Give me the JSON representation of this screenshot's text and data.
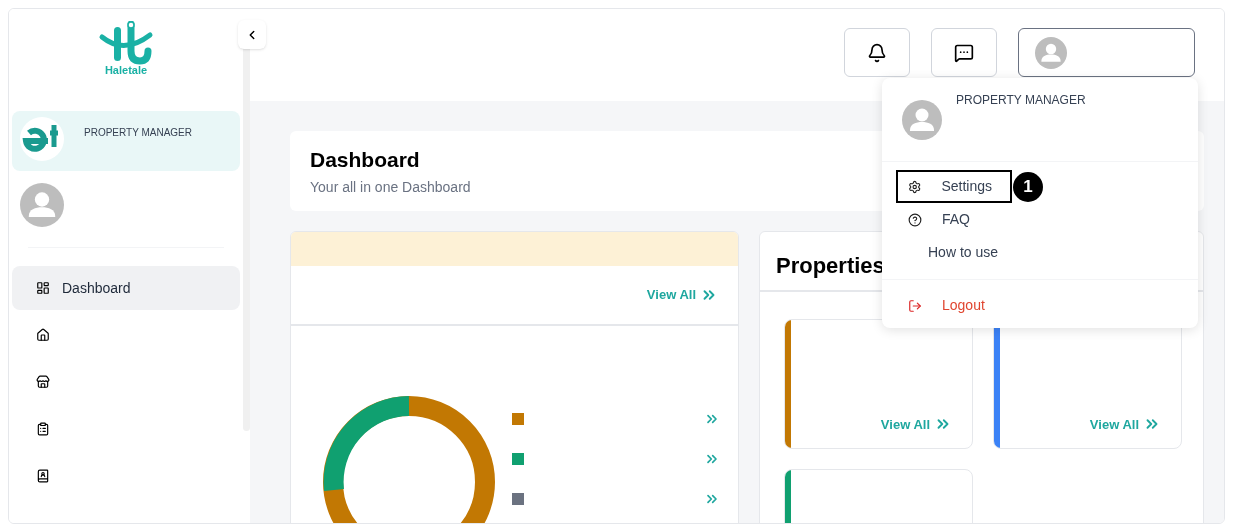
{
  "sidebar": {
    "logo_text": "Haletale",
    "profile": {
      "role": "PROPERTY MANAGER"
    },
    "nav": [
      {
        "kind": "dashboard",
        "label": "Dashboard",
        "selected": true
      },
      {
        "kind": "home",
        "selected": false
      },
      {
        "kind": "store",
        "selected": false
      },
      {
        "kind": "clipboard",
        "selected": false
      },
      {
        "kind": "contacts",
        "selected": false
      }
    ]
  },
  "header": {
    "dropdown": {
      "role": "PROPERTY MANAGER",
      "items": [
        {
          "kind": "settings",
          "label": "Settings",
          "highlighted": true,
          "marker": "1"
        },
        {
          "kind": "faq",
          "label": "FAQ",
          "highlighted": false
        },
        {
          "kind": "help",
          "label": "How to use",
          "highlighted": false
        },
        {
          "kind": "logout",
          "label": "Logout",
          "highlighted": false
        }
      ]
    }
  },
  "page": {
    "title": "Dashboard",
    "subtitle": "Your all in one Dashboard"
  },
  "summary_card": {
    "link": "View All",
    "legend": [
      {
        "color": "#c27803"
      },
      {
        "color": "#10a070"
      },
      {
        "color": "#6b7280"
      }
    ]
  },
  "properties": {
    "title": "Properties",
    "cards": [
      {
        "color": "#c27803",
        "link": "View All"
      },
      {
        "color": "#3b82f6",
        "link": "View All"
      },
      {
        "color": "#10a070"
      }
    ]
  }
}
